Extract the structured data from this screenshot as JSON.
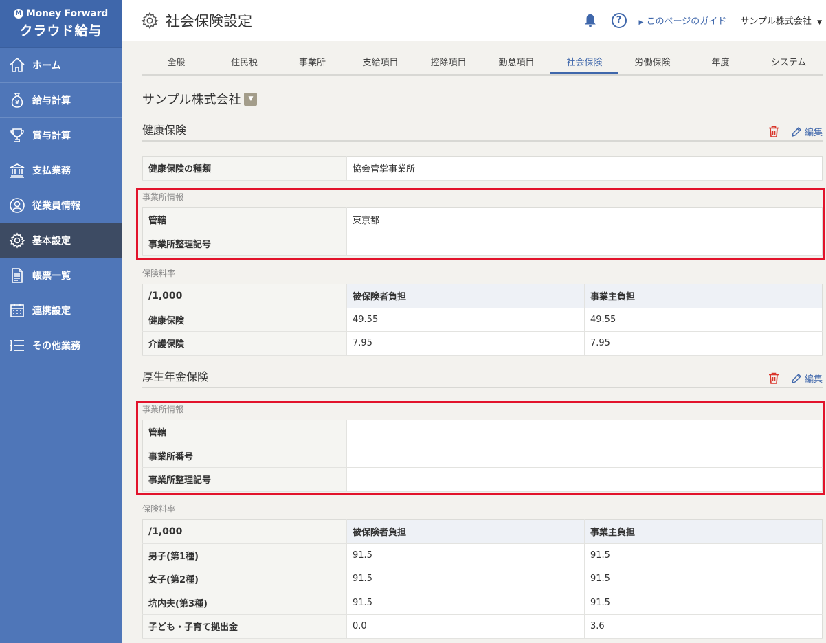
{
  "brand": {
    "top": "Money Forward",
    "bottom": "クラウド給与"
  },
  "nav": [
    {
      "label": "ホーム",
      "icon": "home-icon"
    },
    {
      "label": "給与計算",
      "icon": "money-bag-icon"
    },
    {
      "label": "賞与計算",
      "icon": "trophy-icon"
    },
    {
      "label": "支払業務",
      "icon": "bank-icon"
    },
    {
      "label": "従業員情報",
      "icon": "user-icon"
    },
    {
      "label": "基本設定",
      "icon": "gear-icon"
    },
    {
      "label": "帳票一覧",
      "icon": "document-icon"
    },
    {
      "label": "連携設定",
      "icon": "calendar-icon"
    },
    {
      "label": "その他業務",
      "icon": "list-icon"
    }
  ],
  "header": {
    "title": "社会保険設定",
    "guide": "このページのガイド",
    "company_menu": "サンプル株式会社"
  },
  "tabs": [
    "全般",
    "住民税",
    "事業所",
    "支給項目",
    "控除項目",
    "勤怠項目",
    "社会保険",
    "労働保険",
    "年度",
    "システム"
  ],
  "active_tab": "社会保険",
  "company": "サンプル株式会社",
  "health": {
    "title": "健康保険",
    "edit": "編集",
    "type_label": "健康保険の種類",
    "type_value": "協会管掌事業所",
    "office_title": "事業所情報",
    "office_rows": [
      {
        "label": "管轄",
        "value": "東京都"
      },
      {
        "label": "事業所整理記号",
        "value": ""
      }
    ],
    "rate_title": "保険料率",
    "rate_header": {
      "unit": "/1,000",
      "employee": "被保険者負担",
      "employer": "事業主負担"
    },
    "rate_rows": [
      {
        "label": "健康保険",
        "employee": "49.55",
        "employer": "49.55"
      },
      {
        "label": "介護保険",
        "employee": "7.95",
        "employer": "7.95"
      }
    ]
  },
  "pension": {
    "title": "厚生年金保険",
    "edit": "編集",
    "office_title": "事業所情報",
    "office_rows": [
      {
        "label": "管轄",
        "value": ""
      },
      {
        "label": "事業所番号",
        "value": ""
      },
      {
        "label": "事業所整理記号",
        "value": ""
      }
    ],
    "rate_title": "保険料率",
    "rate_header": {
      "unit": "/1,000",
      "employee": "被保険者負担",
      "employer": "事業主負担"
    },
    "rate_rows": [
      {
        "label": "男子(第1種)",
        "employee": "91.5",
        "employer": "91.5"
      },
      {
        "label": "女子(第2種)",
        "employee": "91.5",
        "employer": "91.5"
      },
      {
        "label": "坑内夫(第3種)",
        "employee": "91.5",
        "employer": "91.5"
      },
      {
        "label": "子ども・子育て拠出金",
        "employee": "0.0",
        "employer": "3.6"
      }
    ]
  },
  "colors": {
    "sidebar": "#4f76b8",
    "accent": "#3f67ab",
    "highlight": "#e2132b",
    "danger": "#d9362b"
  }
}
